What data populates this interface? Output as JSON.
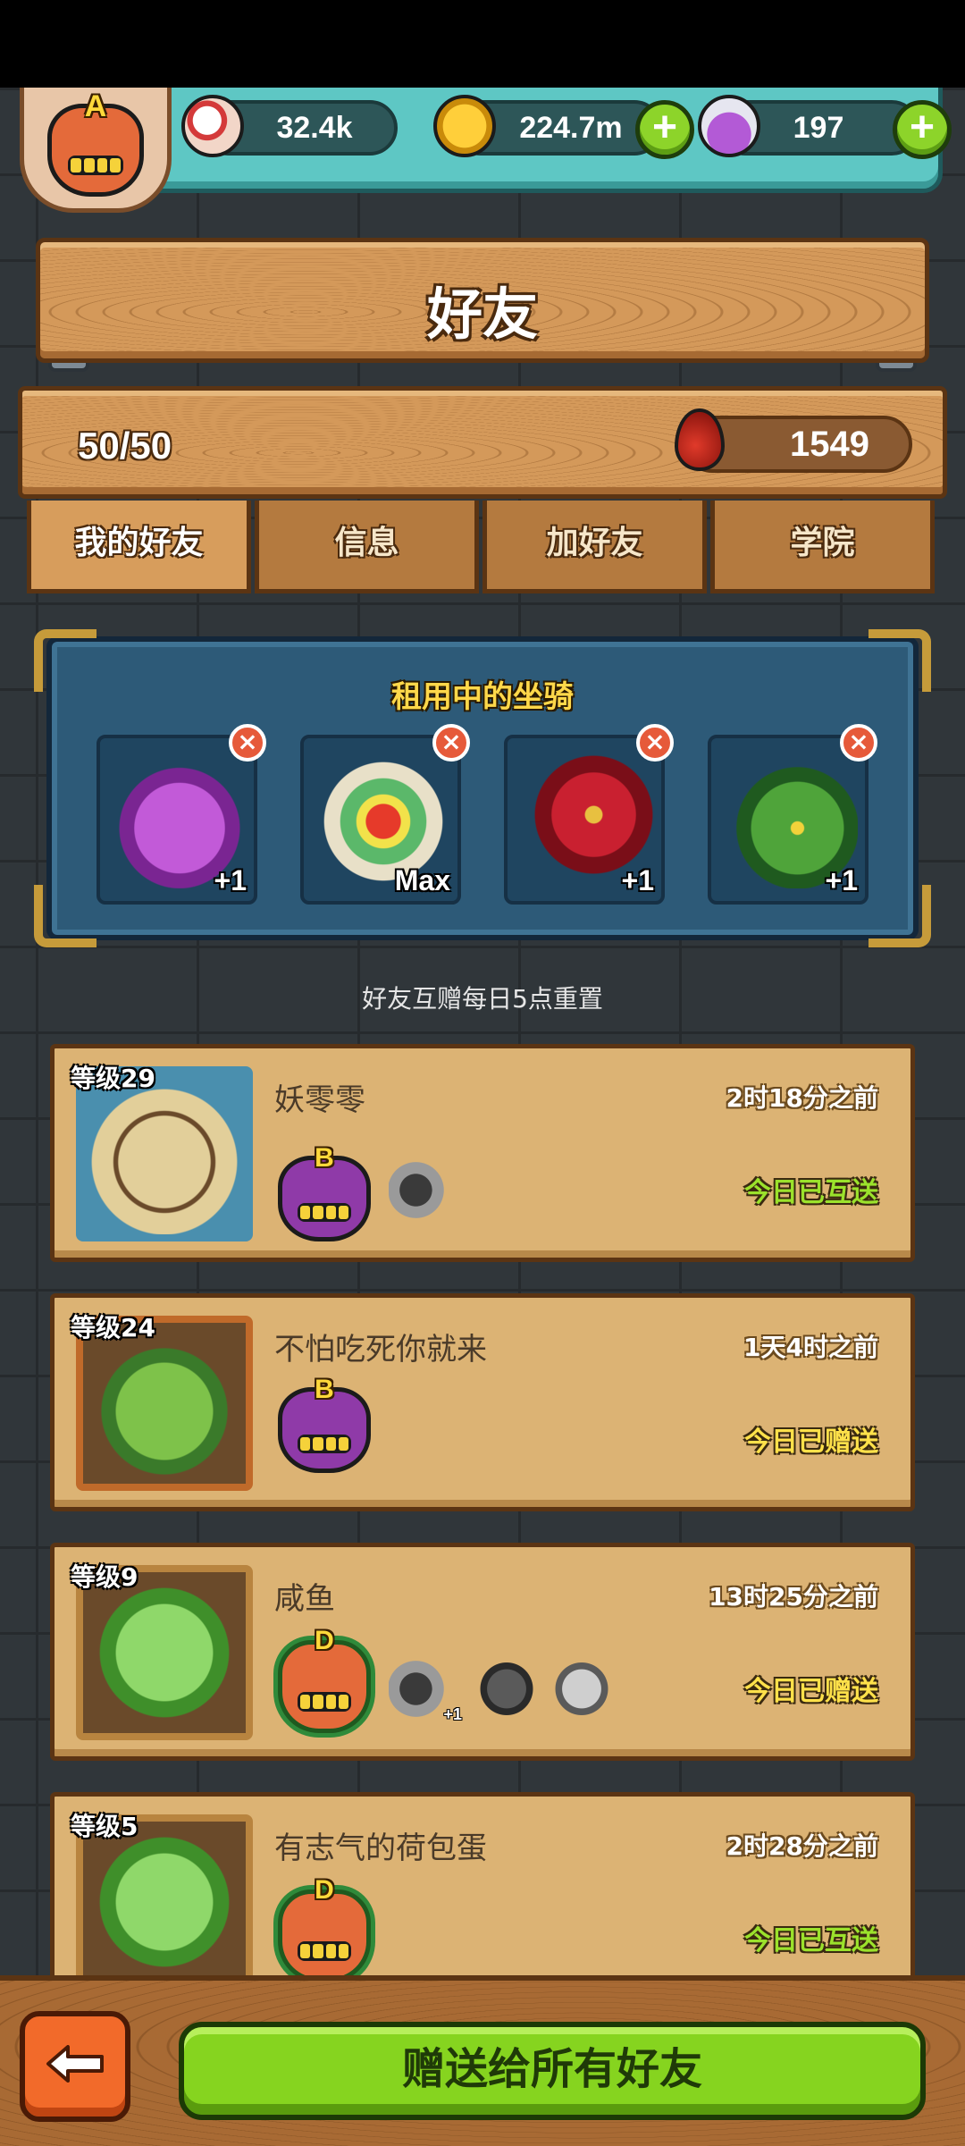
{
  "resources": {
    "eyes": "32.4k",
    "coins": "224.7m",
    "potions": "197",
    "plus_symbol": "+"
  },
  "player_badge": {
    "grade": "A"
  },
  "title": "好友",
  "friend_count": "50/50",
  "blood": "1549",
  "tabs": [
    "我的好友",
    "信息",
    "加好友",
    "学院"
  ],
  "active_tab": "我的好友",
  "mounts": {
    "title": "租用中的坐骑",
    "close_symbol": "×",
    "slots": [
      {
        "icon": "purple-horned-monster-icon",
        "level": "+1",
        "color": "#9a3fb5"
      },
      {
        "icon": "lion-dance-monster-icon",
        "level": "Max",
        "color": "#d9d0b5"
      },
      {
        "icon": "red-rose-monster-icon",
        "level": "+1",
        "color": "#b31e2a"
      },
      {
        "icon": "christmas-tree-monster-icon",
        "level": "+1",
        "color": "#3f8a2f"
      }
    ]
  },
  "reset_note": "好友互赠每日5点重置",
  "friends": [
    {
      "level": "等级29",
      "name": "妖零零",
      "time": "2时18分之前",
      "status": "今日已互送",
      "status_type": "mutual",
      "badge": "B",
      "badge_color": "#8f3aa8",
      "portrait": "tangled-roots-monster-portrait",
      "portrait_color": "#4a8fae",
      "mounts": [
        "cart-mount-icon"
      ],
      "mount_levels": [
        ""
      ]
    },
    {
      "level": "等级24",
      "name": "不怕吃死你就来",
      "time": "1天4时之前",
      "status": "今日已赠送",
      "status_type": "sent",
      "badge": "B",
      "badge_color": "#8f3aa8",
      "portrait": "green-slug-monster-portrait",
      "portrait_color": "#c06a2a",
      "mounts": [],
      "mount_levels": []
    },
    {
      "level": "等级9",
      "name": "咸鱼",
      "time": "13时25分之前",
      "status": "今日已赠送",
      "status_type": "sent",
      "badge": "D",
      "badge_color": "#2f8a3a",
      "portrait": "lettuce-monster-portrait",
      "portrait_color": "#b8843f",
      "mounts": [
        "cart-mount-icon",
        "spiky-pig-mount-icon",
        "pufferfish-mount-icon"
      ],
      "mount_levels": [
        "+1",
        "",
        ""
      ]
    },
    {
      "level": "等级5",
      "name": "有志气的荷包蛋",
      "time": "2时28分之前",
      "status": "今日已互送",
      "status_type": "mutual",
      "badge": "D",
      "badge_color": "#2f8a3a",
      "portrait": "lettuce-monster-portrait",
      "portrait_color": "#b8843f",
      "mounts": [],
      "mount_levels": []
    }
  ],
  "gift_all_label": "赠送给所有好友",
  "colors": {
    "mutual": "#9be22c",
    "sent": "#ffe14a",
    "gift_button": "#86d41f",
    "back_button": "#f26a2a"
  }
}
